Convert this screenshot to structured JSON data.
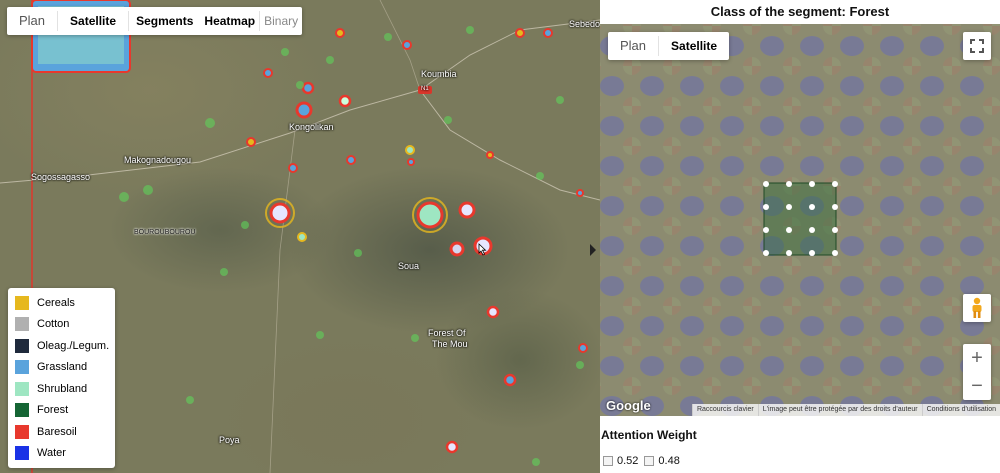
{
  "left_map": {
    "map_types": {
      "plan": "Plan",
      "satellite": "Satellite",
      "segments": "Segments",
      "heatmap": "Heatmap",
      "binary": "Binary"
    },
    "places": [
      {
        "name": "Koumbia",
        "style": "light"
      },
      {
        "name": "Kongolikan",
        "style": "light"
      },
      {
        "name": "Makognadougou",
        "style": "light"
      },
      {
        "name": "Sogossagasso",
        "style": "light"
      },
      {
        "name": "BOUROUBOUROU",
        "style": "dark"
      },
      {
        "name": "Soua",
        "style": "light"
      },
      {
        "name": "Forest Of",
        "style": "light"
      },
      {
        "name": "The Mou",
        "style": "light"
      },
      {
        "name": "Poya",
        "style": "light"
      },
      {
        "name": "Sebedo",
        "style": "light"
      },
      {
        "name": "N1",
        "style": "shield"
      }
    ],
    "legend": [
      {
        "label": "Cereals",
        "color": "#e6b81e"
      },
      {
        "label": "Cotton",
        "color": "#b0b0b0"
      },
      {
        "label": "Oleag./Legum.",
        "color": "#1f2a3c"
      },
      {
        "label": "Grassland",
        "color": "#5aa3dc"
      },
      {
        "label": "Shrubland",
        "color": "#9ee6c2"
      },
      {
        "label": "Forest",
        "color": "#156534"
      },
      {
        "label": "Baresoil",
        "color": "#e8382d"
      },
      {
        "label": "Water",
        "color": "#1a32e6"
      }
    ]
  },
  "right_panel": {
    "title": "Class of the segment: Forest",
    "map_types": {
      "plan": "Plan",
      "satellite": "Satellite"
    },
    "google_logo": "Google",
    "attribution": [
      "Raccourcis clavier",
      "L'image peut être protégée par des droits d'auteur",
      "Conditions d'utilisation"
    ],
    "attention_title": "Attention Weight",
    "weights": [
      "0.52",
      "0.48"
    ]
  }
}
